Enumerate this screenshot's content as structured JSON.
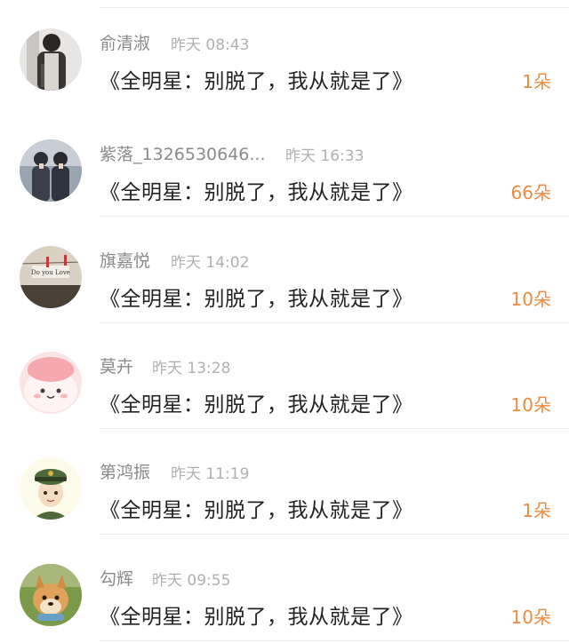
{
  "items": [
    {
      "name": "紫落_1326530646...",
      "time": "昨天 16:33",
      "title": "《全明星：别脱了，我从就是了》",
      "flowers": "66朵",
      "avatar": "couple-photo-avatar"
    },
    {
      "name": "旗嘉悦",
      "time": "昨天 14:02",
      "title": "《全明星：别脱了，我从就是了》",
      "flowers": "10朵",
      "avatar": "do-you-love-photo-avatar"
    },
    {
      "name": "莫卉",
      "time": "昨天 13:28",
      "title": "《全明星：别脱了，我从就是了》",
      "flowers": "10朵",
      "avatar": "pink-cartoon-avatar"
    },
    {
      "name": "第鸿振",
      "time": "昨天 11:19",
      "title": "《全明星：别脱了，我从就是了》",
      "flowers": "1朵",
      "avatar": "soldier-cartoon-avatar"
    },
    {
      "name": "勾辉",
      "time": "昨天 09:55",
      "title": "《全明星：别脱了，我从就是了》",
      "flowers": "10朵",
      "avatar": "dog-photo-avatar"
    },
    {
      "name": "俞清淑",
      "time": "昨天 08:43",
      "title": "《全明星：别脱了，我从就是了》",
      "flowers": "1朵",
      "avatar": "person-photo-avatar"
    }
  ],
  "colors": {
    "name": "#8a8a8a",
    "time": "#b0b0b0",
    "title": "#222222",
    "flowers": "#f08a3e"
  }
}
